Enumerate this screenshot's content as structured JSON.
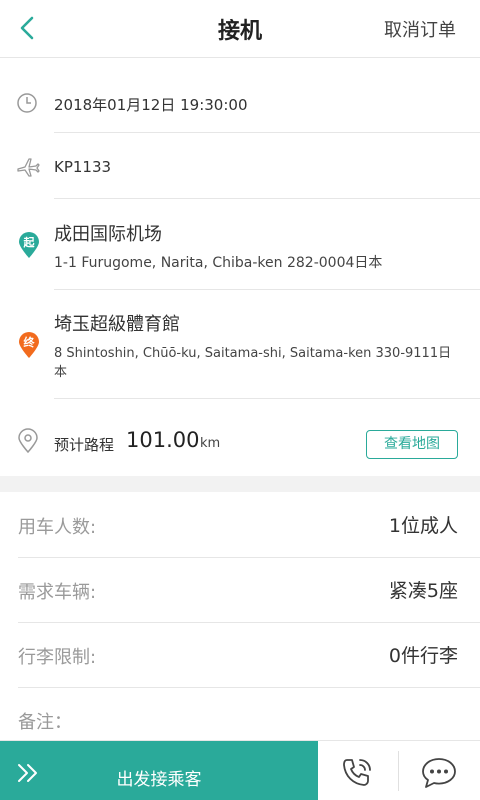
{
  "header": {
    "title": "接机",
    "cancel_label": "取消订单"
  },
  "order": {
    "datetime": "2018年01月12日 19:30:00",
    "flight": "KP1133",
    "start_badge": "起",
    "start_name": "成田国际机场",
    "start_address": "1-1 Furugome, Narita, Chiba-ken 282-0004日本",
    "end_badge": "终",
    "end_name": "埼玉超級體育館",
    "end_address_line1": "8 Shintoshin, Chūō-ku, Saitama-shi, Saitama-ken 330-9111日",
    "end_address_line2": "本",
    "distance_label": "预计路程",
    "distance_value": "101.00",
    "distance_unit": "km",
    "map_button": "查看地图"
  },
  "details": [
    {
      "label": "用车人数:",
      "value": "1位成人"
    },
    {
      "label": "需求车辆:",
      "value": "紧凑5座"
    },
    {
      "label": "行李限制:",
      "value": "0件行李"
    },
    {
      "label": "备注：",
      "value": ""
    }
  ],
  "bottom": {
    "go_label": "出发接乘客"
  },
  "colors": {
    "accent": "#2aaa9a",
    "start_badge": "#2aaa9a",
    "end_badge": "#f26b1d"
  }
}
